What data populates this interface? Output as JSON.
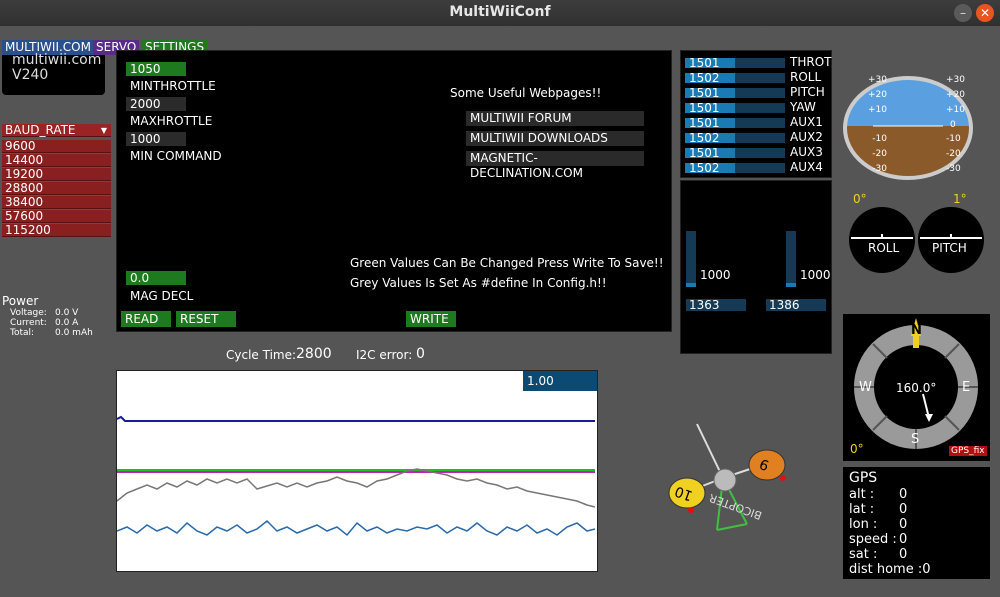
{
  "window": {
    "title": "MultiWiiConf"
  },
  "tabs": [
    {
      "label": "MULTIWII.COM",
      "color": "#2a4f8a"
    },
    {
      "label": "SERVO",
      "color": "#5a2a8a"
    },
    {
      "label": "SETTINGS",
      "color": "#1e7a1e"
    }
  ],
  "logo": {
    "line1": "multiwii.com",
    "line2": "V240"
  },
  "baud": {
    "header": "BAUD_RATE",
    "options": [
      "9600",
      "14400",
      "19200",
      "28800",
      "38400",
      "57600",
      "115200"
    ]
  },
  "power": {
    "title": "Power",
    "voltage_label": "Voltage:",
    "voltage": "0.0 V",
    "current_label": "Current:",
    "current": "0.0 A",
    "total_label": "Total:",
    "total": "0.0 mAh"
  },
  "settings": {
    "minthrottle_value": "1050",
    "minthrottle_label": "MINTHROTTLE",
    "maxthrottle_value": "2000",
    "maxthrottle_label": "MAXHROTTLE",
    "mincommand_value": "1000",
    "mincommand_label": "MIN COMMAND",
    "magdecl_value": "0.0",
    "magdecl_label": "MAG DECL",
    "useful_title": "Some Useful Webpages!!",
    "links": [
      "MULTIWII FORUM",
      "MULTIWII DOWNLOADS",
      "MAGNETIC-DECLINATION.COM"
    ],
    "note_green": "Green Values Can Be Changed Press Write To Save!!",
    "note_grey": "Grey Values Is Set As #define In Config.h!!",
    "read_label": "READ",
    "reset_label": "RESET",
    "write_label": "WRITE"
  },
  "status": {
    "cycle_label": "Cycle Time:",
    "cycle_value": "2800",
    "i2c_label": "I2C error:",
    "i2c_value": "0"
  },
  "graph": {
    "scale_label": "1.00"
  },
  "rc": [
    {
      "value": "1501",
      "name": "THROT",
      "level": 0.5
    },
    {
      "value": "1502",
      "name": "ROLL",
      "level": 0.5
    },
    {
      "value": "1501",
      "name": "PITCH",
      "level": 0.5
    },
    {
      "value": "1501",
      "name": "YAW",
      "level": 0.5
    },
    {
      "value": "1501",
      "name": "AUX1",
      "level": 0.5
    },
    {
      "value": "1502",
      "name": "AUX2",
      "level": 0.5
    },
    {
      "value": "1501",
      "name": "AUX3",
      "level": 0.5
    },
    {
      "value": "1502",
      "name": "AUX4",
      "level": 0.5
    }
  ],
  "motors": {
    "left_value": "1000",
    "right_value": "1000",
    "left_bottom": "1363",
    "right_bottom": "1386"
  },
  "horizon": {
    "scale_left": [
      "+30",
      "+20",
      "+10",
      "-10",
      "-20",
      "-30"
    ],
    "scale_right": [
      "+30",
      "+20",
      "+10",
      "-10",
      "-20",
      "-30"
    ],
    "zero": "0"
  },
  "attitude": {
    "roll_value": "0°",
    "roll_label": "ROLL",
    "pitch_value": "1°",
    "pitch_label": "PITCH"
  },
  "compass": {
    "n": "N",
    "e": "E",
    "s": "S",
    "w": "W",
    "heading": "160.0°",
    "offset": "0°",
    "gps_fix": "GPS_fix"
  },
  "gps": {
    "title": "GPS",
    "alt_label": "alt  :",
    "alt": "0",
    "lat_label": "lat  :",
    "lat": "0",
    "lon_label": "lon  :",
    "lon": "0",
    "speed_label": "speed :",
    "speed": "0",
    "sat_label": "sat  :",
    "sat": "0",
    "dist_label": "dist home :",
    "dist": "0"
  },
  "bicopter": {
    "label": "BICOPTER",
    "motor1": "10",
    "motor2": "9"
  }
}
